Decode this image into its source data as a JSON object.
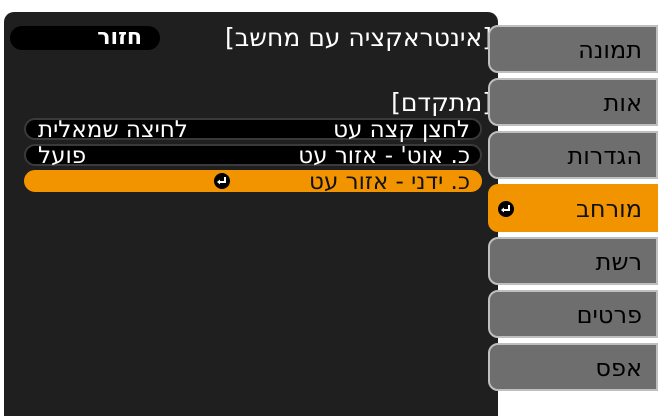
{
  "menu": {
    "back_button": "חזור",
    "page_title": "[אינטראקציה עם מחשב]",
    "section_title": "[מתקדם]",
    "rows": [
      {
        "label": "לחצן קצה עט",
        "value": "לחיצה שמאלית"
      },
      {
        "label": "כ. אוט' - אזור עט",
        "value": "פועל"
      },
      {
        "label": "כ. ידני - אזור עט",
        "value": ""
      }
    ],
    "selected_row": 2
  },
  "tabs": [
    {
      "label": "תמונה"
    },
    {
      "label": "אות"
    },
    {
      "label": "הגדרות"
    },
    {
      "label": "מורחב"
    },
    {
      "label": "רשת"
    },
    {
      "label": "פרטים"
    },
    {
      "label": "אפס"
    }
  ],
  "active_tab": 3,
  "colors": {
    "panel": "#1f1f1f",
    "tab_inactive": "#6e6e6e",
    "highlight": "#f29400"
  },
  "icons": {
    "enter": "enter-return-icon"
  }
}
